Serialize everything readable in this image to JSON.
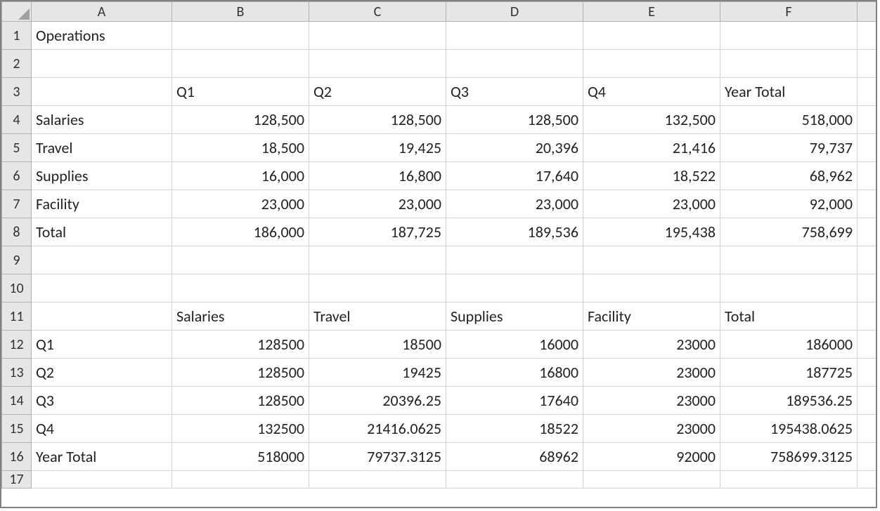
{
  "columns": [
    "A",
    "B",
    "C",
    "D",
    "E",
    "F"
  ],
  "rowNumbers": [
    "1",
    "2",
    "3",
    "4",
    "5",
    "6",
    "7",
    "8",
    "9",
    "10",
    "11",
    "12",
    "13",
    "14",
    "15",
    "16",
    "17"
  ],
  "cells": {
    "A1": {
      "v": "Operations",
      "align": "left"
    },
    "B3": {
      "v": "Q1",
      "align": "left"
    },
    "C3": {
      "v": "Q2",
      "align": "left"
    },
    "D3": {
      "v": "Q3",
      "align": "left"
    },
    "E3": {
      "v": "Q4",
      "align": "left"
    },
    "F3": {
      "v": "Year Total",
      "align": "left"
    },
    "A4": {
      "v": "Salaries",
      "align": "left"
    },
    "B4": {
      "v": "128,500",
      "align": "right"
    },
    "C4": {
      "v": "128,500",
      "align": "right"
    },
    "D4": {
      "v": "128,500",
      "align": "right"
    },
    "E4": {
      "v": "132,500",
      "align": "right"
    },
    "F4": {
      "v": "518,000",
      "align": "right"
    },
    "A5": {
      "v": "Travel",
      "align": "left"
    },
    "B5": {
      "v": "18,500",
      "align": "right"
    },
    "C5": {
      "v": "19,425",
      "align": "right"
    },
    "D5": {
      "v": "20,396",
      "align": "right"
    },
    "E5": {
      "v": "21,416",
      "align": "right"
    },
    "F5": {
      "v": "79,737",
      "align": "right"
    },
    "A6": {
      "v": "Supplies",
      "align": "left"
    },
    "B6": {
      "v": "16,000",
      "align": "right"
    },
    "C6": {
      "v": "16,800",
      "align": "right"
    },
    "D6": {
      "v": "17,640",
      "align": "right"
    },
    "E6": {
      "v": "18,522",
      "align": "right"
    },
    "F6": {
      "v": "68,962",
      "align": "right"
    },
    "A7": {
      "v": "Facility",
      "align": "left"
    },
    "B7": {
      "v": "23,000",
      "align": "right"
    },
    "C7": {
      "v": "23,000",
      "align": "right"
    },
    "D7": {
      "v": "23,000",
      "align": "right"
    },
    "E7": {
      "v": "23,000",
      "align": "right"
    },
    "F7": {
      "v": "92,000",
      "align": "right"
    },
    "A8": {
      "v": "Total",
      "align": "left"
    },
    "B8": {
      "v": "186,000",
      "align": "right"
    },
    "C8": {
      "v": "187,725",
      "align": "right"
    },
    "D8": {
      "v": "189,536",
      "align": "right"
    },
    "E8": {
      "v": "195,438",
      "align": "right"
    },
    "F8": {
      "v": "758,699",
      "align": "right"
    },
    "B11": {
      "v": "Salaries",
      "align": "left"
    },
    "C11": {
      "v": "Travel",
      "align": "left"
    },
    "D11": {
      "v": "Supplies",
      "align": "left"
    },
    "E11": {
      "v": "Facility",
      "align": "left"
    },
    "F11": {
      "v": "Total",
      "align": "left"
    },
    "A12": {
      "v": "Q1",
      "align": "left"
    },
    "B12": {
      "v": "128500",
      "align": "right"
    },
    "C12": {
      "v": "18500",
      "align": "right"
    },
    "D12": {
      "v": "16000",
      "align": "right"
    },
    "E12": {
      "v": "23000",
      "align": "right"
    },
    "F12": {
      "v": "186000",
      "align": "right"
    },
    "A13": {
      "v": "Q2",
      "align": "left"
    },
    "B13": {
      "v": "128500",
      "align": "right"
    },
    "C13": {
      "v": "19425",
      "align": "right"
    },
    "D13": {
      "v": "16800",
      "align": "right"
    },
    "E13": {
      "v": "23000",
      "align": "right"
    },
    "F13": {
      "v": "187725",
      "align": "right"
    },
    "A14": {
      "v": "Q3",
      "align": "left"
    },
    "B14": {
      "v": "128500",
      "align": "right"
    },
    "C14": {
      "v": "20396.25",
      "align": "right"
    },
    "D14": {
      "v": "17640",
      "align": "right"
    },
    "E14": {
      "v": "23000",
      "align": "right"
    },
    "F14": {
      "v": "189536.25",
      "align": "right"
    },
    "A15": {
      "v": "Q4",
      "align": "left"
    },
    "B15": {
      "v": "132500",
      "align": "right"
    },
    "C15": {
      "v": "21416.0625",
      "align": "right"
    },
    "D15": {
      "v": "18522",
      "align": "right"
    },
    "E15": {
      "v": "23000",
      "align": "right"
    },
    "F15": {
      "v": "195438.0625",
      "align": "right"
    },
    "A16": {
      "v": "Year Total",
      "align": "left"
    },
    "B16": {
      "v": "518000",
      "align": "right"
    },
    "C16": {
      "v": "79737.3125",
      "align": "right"
    },
    "D16": {
      "v": "68962",
      "align": "right"
    },
    "E16": {
      "v": "92000",
      "align": "right"
    },
    "F16": {
      "v": "758699.3125",
      "align": "right"
    }
  }
}
